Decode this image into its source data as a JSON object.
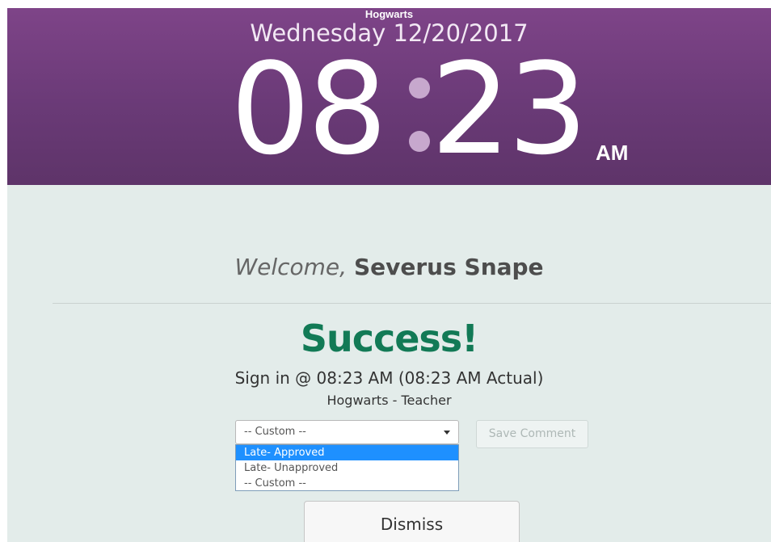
{
  "header": {
    "site_name": "Hogwarts",
    "date": "Wednesday 12/20/2017",
    "hours": "08",
    "minutes": "23",
    "ampm": "AM"
  },
  "welcome": {
    "greeting": "Welcome,",
    "name": "Severus Snape"
  },
  "status": {
    "title": "Success!",
    "signin_text": "Sign in @ 08:23 AM (08:23 AM Actual)",
    "location_role": "Hogwarts - Teacher"
  },
  "comment": {
    "selected_value": "-- Custom --",
    "options": [
      "Late- Approved",
      "Late- Unapproved",
      "-- Custom --"
    ],
    "highlighted_option": "Late- Approved",
    "save_label": "Save Comment"
  },
  "actions": {
    "dismiss_label": "Dismiss"
  },
  "colors": {
    "header_purple": "#6a3a77",
    "success_green": "#127a56",
    "background": "#e3ecea",
    "highlight_blue": "#1e90ff"
  }
}
